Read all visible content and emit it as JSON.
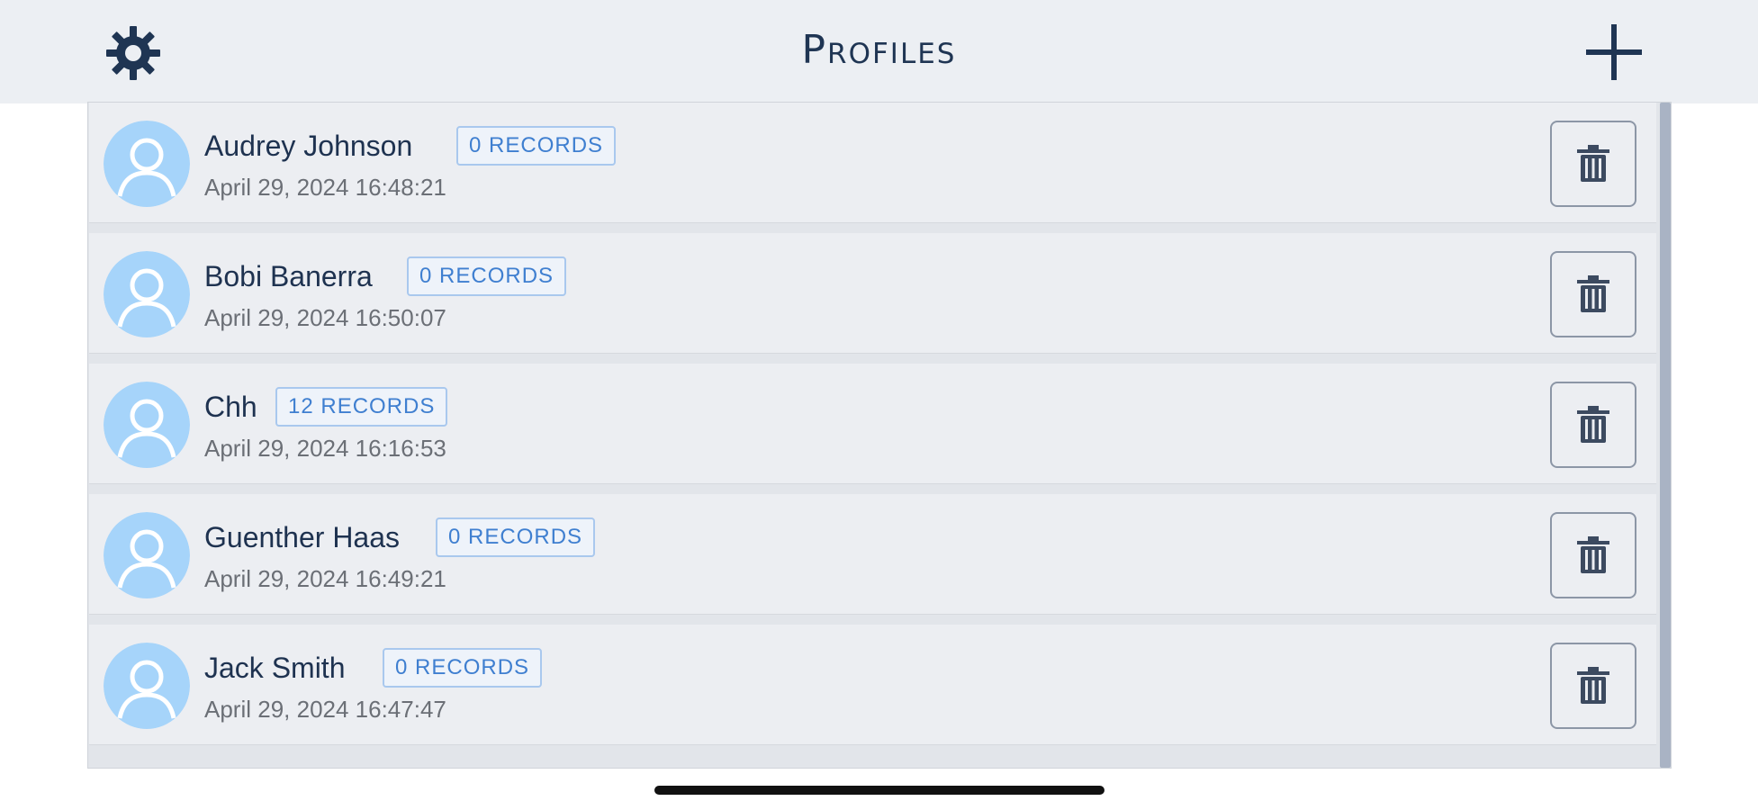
{
  "header": {
    "title": "Profiles",
    "settings_icon": "gear-icon",
    "add_icon": "plus-icon"
  },
  "profiles": [
    {
      "name": "Audrey Johnson",
      "records": "0 RECORDS",
      "date": "April 29, 2024 16:48:21"
    },
    {
      "name": "Bobi Banerra",
      "records": "0 RECORDS",
      "date": "April 29, 2024 16:50:07"
    },
    {
      "name": "Chh",
      "records": "12 RECORDS",
      "date": "April 29, 2024 16:16:53"
    },
    {
      "name": "Guenther Haas",
      "records": "0 RECORDS",
      "date": "April 29, 2024 16:49:21"
    },
    {
      "name": "Jack Smith",
      "records": "0 RECORDS",
      "date": "April 29, 2024 16:47:47"
    }
  ],
  "colors": {
    "accent": "#3f7fd0",
    "title": "#1f3553",
    "avatar": "#a6d4fa",
    "topbar": "#eceff3"
  }
}
